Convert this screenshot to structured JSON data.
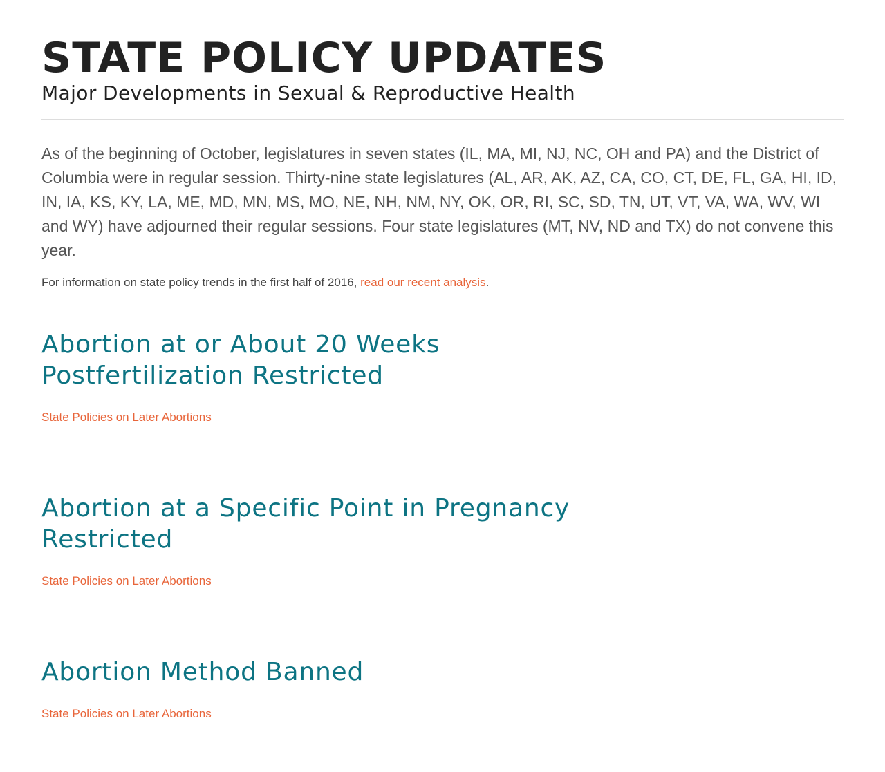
{
  "header": {
    "title": "STATE POLICY UPDATES",
    "subtitle": "Major Developments in Sexual & Reproductive Health"
  },
  "intro": {
    "paragraph": "As of the beginning of October, legislatures in seven states (IL, MA, MI, NJ, NC, OH and PA) and the District of Columbia were in regular session. Thirty-nine state legislatures (AL, AR, AK, AZ, CA, CO, CT, DE, FL, GA, HI, ID, IN, IA, KS, KY, LA, ME, MD, MN, MS, MO, NE, NH, NM, NY, OK, OR, RI, SC, SD, TN, UT, VT, VA, WA, WV, WI and WY) have adjourned their regular sessions. Four state legislatures (MT, NV, ND and TX) do not convene this year.",
    "note_prefix": "For information on state policy trends in the first half of 2016, ",
    "note_link": "read our recent analysis",
    "note_suffix": "."
  },
  "sections": [
    {
      "heading": "Abortion at or About 20 Weeks Postfertilization Restricted",
      "link": "State Policies on Later Abortions"
    },
    {
      "heading": "Abortion at a Specific Point in Pregnancy Restricted",
      "link": "State Policies on Later Abortions"
    },
    {
      "heading": "Abortion Method Banned",
      "link": "State Policies on Later Abortions"
    }
  ],
  "colors": {
    "title": "#222222",
    "body_text": "#555555",
    "heading_teal": "#0d7483",
    "link_orange": "#e8653a",
    "divider": "#dddddd"
  }
}
